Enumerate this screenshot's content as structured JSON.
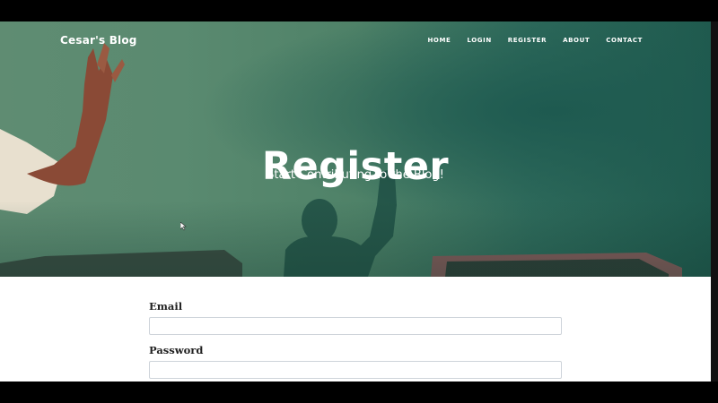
{
  "navbar": {
    "brand": "Cesar's Blog",
    "links": [
      "HOME",
      "LOGIN",
      "REGISTER",
      "ABOUT",
      "CONTACT"
    ]
  },
  "hero": {
    "title": "Register",
    "subtitle": "Start Contributing to the Blog!"
  },
  "form": {
    "email_label": "Email",
    "email_value": "",
    "password_label": "Password",
    "password_value": ""
  },
  "colors": {
    "hero_green": "#4f8268",
    "hero_dark_teal": "#1f5a4e",
    "text_dark": "#222222",
    "input_border": "#ced4da"
  }
}
